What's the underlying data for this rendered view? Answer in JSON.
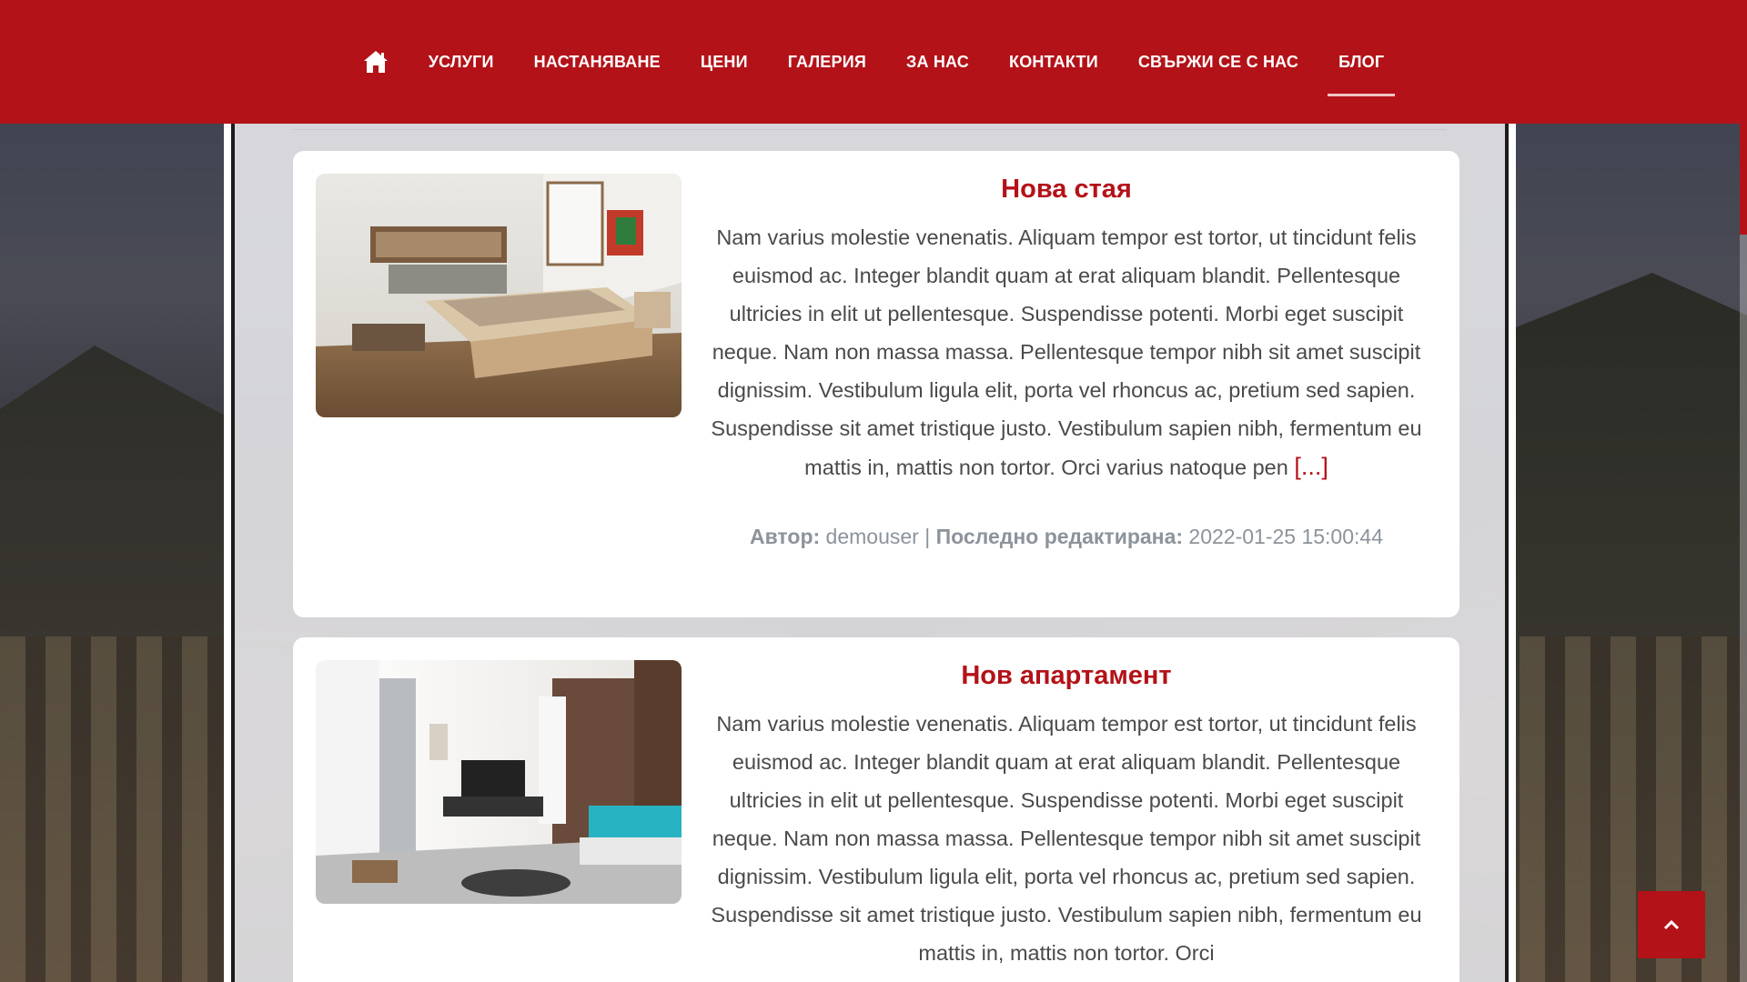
{
  "nav": {
    "items": [
      {
        "label": "УСЛУГИ"
      },
      {
        "label": "НАСТАНЯВАНЕ"
      },
      {
        "label": "ЦЕНИ"
      },
      {
        "label": "ГАЛЕРИЯ"
      },
      {
        "label": "ЗА НАС"
      },
      {
        "label": "КОНТАКТИ"
      },
      {
        "label": "СВЪРЖИ СЕ С НАС"
      },
      {
        "label": "БЛОГ"
      }
    ],
    "active": "БЛОГ"
  },
  "posts": [
    {
      "title": "Нова стая",
      "text": "Nam varius molestie venenatis. Aliquam tempor est tortor, ut tincidunt felis euismod ac. Integer blandit quam at erat aliquam blandit. Pellentesque ultricies in elit ut pellentesque. Suspendisse potenti. Morbi eget suscipit neque. Nam non massa massa. Pellentesque tempor nibh sit amet suscipit dignissim. Vestibulum ligula elit, porta vel rhoncus ac, pretium sed sapien. Suspendisse sit amet tristique justo. Vestibulum sapien nibh, fermentum eu mattis in, mattis non tortor. Orci varius natoque pen",
      "more": "[...]",
      "author_label": "Автор:",
      "author": "demouser",
      "separator": "|",
      "edited_label": "Последно редактирана:",
      "edited": "2022-01-25 15:00:44"
    },
    {
      "title": "Нов апартамент",
      "text": "Nam varius molestie venenatis. Aliquam tempor est tortor, ut tincidunt felis euismod ac. Integer blandit quam at erat aliquam blandit. Pellentesque ultricies in elit ut pellentesque. Suspendisse potenti. Morbi eget suscipit neque. Nam non massa massa. Pellentesque tempor nibh sit amet suscipit dignissim. Vestibulum ligula elit, porta vel rhoncus ac, pretium sed sapien. Suspendisse sit amet tristique justo. Vestibulum sapien nibh, fermentum eu mattis in, mattis non tortor. Orci"
    }
  ],
  "colors": {
    "brand": "#b31218",
    "text": "#4a4a4a",
    "meta": "#8c939b"
  },
  "icons": {
    "home": "home-icon",
    "to_top": "chevron-up-icon"
  }
}
